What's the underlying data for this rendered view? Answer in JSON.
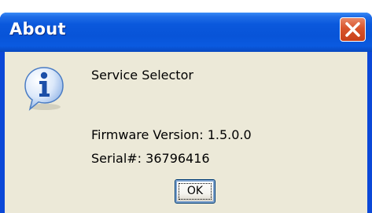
{
  "window": {
    "title": "About",
    "close_icon": "close-icon"
  },
  "dialog": {
    "icon": "info-icon",
    "app_name": "Service Selector",
    "firmware": "Firmware Version: 1.5.0.0",
    "serial": "Serial#: 36796416",
    "ok_label": "OK"
  },
  "colors": {
    "titlebar": "#0854d8",
    "client": "#ece9d8",
    "close_button": "#d8542c"
  }
}
